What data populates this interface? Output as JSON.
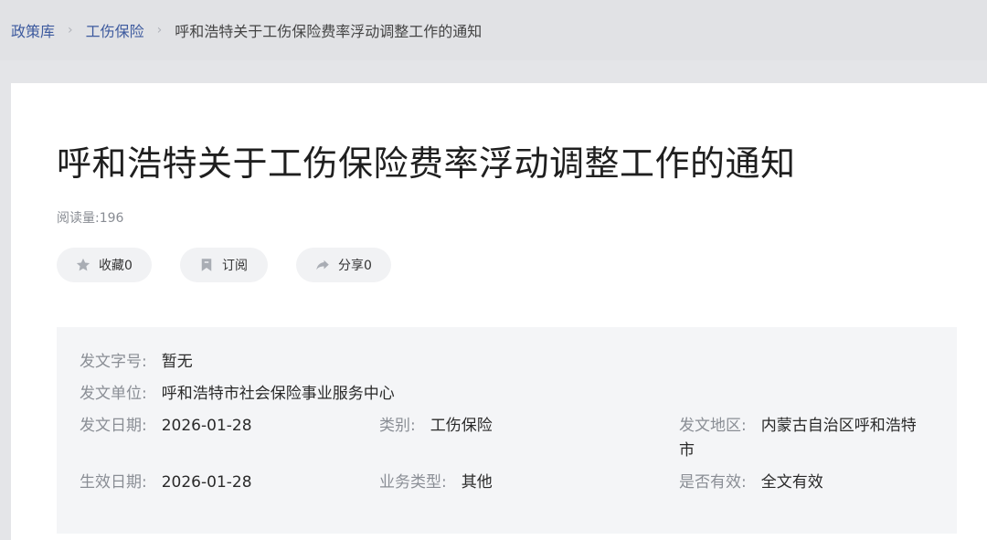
{
  "breadcrumb": {
    "items": [
      "政策库",
      "工伤保险"
    ],
    "current": "呼和浩特关于工伤保险费率浮动调整工作的通知",
    "separator": "›"
  },
  "article": {
    "title": "呼和浩特关于工伤保险费率浮动调整工作的通知",
    "read_count": "阅读量:196"
  },
  "actions": {
    "collect": {
      "label": "收藏0",
      "icon": "star-icon"
    },
    "subscribe": {
      "label": "订阅",
      "icon": "bookmark-icon"
    },
    "share": {
      "label": "分享0",
      "icon": "share-arrow-icon"
    }
  },
  "meta": {
    "doc_number_label": "发文字号:",
    "doc_number": "暂无",
    "issuer_label": "发文单位:",
    "issuer": "呼和浩特市社会保险事业服务中心",
    "issue_date_label": "发文日期:",
    "issue_date": "2026-01-28",
    "category_label": "类别:",
    "category": "工伤保险",
    "region_label": "发文地区:",
    "region_line1": "内蒙古自治区呼和浩特",
    "region_line2": "市",
    "effective_date_label": "生效日期:",
    "effective_date": "2026-01-28",
    "business_type_label": "业务类型:",
    "business_type": "其他",
    "validity_label": "是否有效:",
    "validity": "全文有效"
  },
  "colors": {
    "link": "#3d5a9e",
    "page_bg": "#e4e5e8",
    "meta_bg": "#f4f5f7",
    "button_bg": "#f1f2f4",
    "label_text": "#8a8e95"
  }
}
